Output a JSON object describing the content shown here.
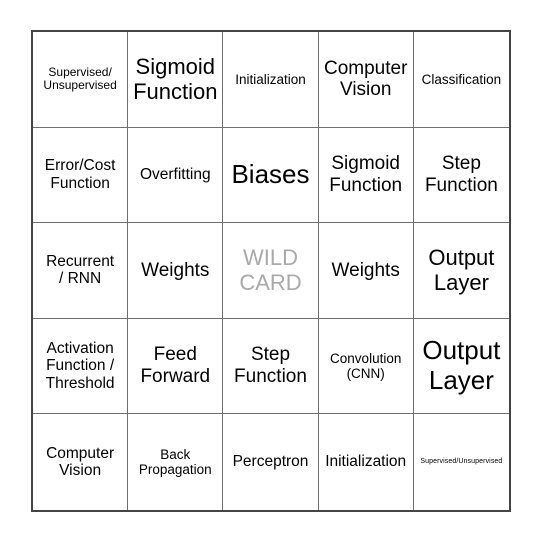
{
  "card": {
    "name": "neural-network-terms-bingo-card",
    "free_space_label": "WILD\nCARD",
    "free_space_color": "#a9a9a9",
    "border_color": "#444444",
    "grid_line_color": "#6e6e6e",
    "text_color": "#000000",
    "background_color": "#ffffff",
    "rows": 5,
    "columns": 5,
    "cells": [
      {
        "id": "r1c1",
        "text": "Supervised/\nUnsupervised",
        "size": "sz-xs",
        "free": false
      },
      {
        "id": "r1c2",
        "text": "Sigmoid\nFunction",
        "size": "sz-xl",
        "free": false
      },
      {
        "id": "r1c3",
        "text": "Initialization",
        "size": "sz-sm",
        "free": false
      },
      {
        "id": "r1c4",
        "text": "Computer\nVision",
        "size": "sz-lg",
        "free": false
      },
      {
        "id": "r1c5",
        "text": "Classification",
        "size": "sz-sm",
        "free": false
      },
      {
        "id": "r2c1",
        "text": "Error/Cost\nFunction",
        "size": "sz-md",
        "free": false
      },
      {
        "id": "r2c2",
        "text": "Overfitting",
        "size": "sz-md",
        "free": false
      },
      {
        "id": "r2c3",
        "text": "Biases",
        "size": "sz-xxl",
        "free": false
      },
      {
        "id": "r2c4",
        "text": "Sigmoid\nFunction",
        "size": "sz-lg",
        "free": false
      },
      {
        "id": "r2c5",
        "text": "Step\nFunction",
        "size": "sz-lg",
        "free": false
      },
      {
        "id": "r3c1",
        "text": "Recurrent\n/ RNN",
        "size": "sz-md",
        "free": false
      },
      {
        "id": "r3c2",
        "text": "Weights",
        "size": "sz-lg",
        "free": false
      },
      {
        "id": "r3c3",
        "text": "WILD\nCARD",
        "size": "sz-xl",
        "free": true
      },
      {
        "id": "r3c4",
        "text": "Weights",
        "size": "sz-lg",
        "free": false
      },
      {
        "id": "r3c5",
        "text": "Output\nLayer",
        "size": "sz-xl",
        "free": false
      },
      {
        "id": "r4c1",
        "text": "Activation\nFunction /\nThreshold",
        "size": "sz-md",
        "free": false
      },
      {
        "id": "r4c2",
        "text": "Feed\nForward",
        "size": "sz-lg",
        "free": false
      },
      {
        "id": "r4c3",
        "text": "Step\nFunction",
        "size": "sz-lg",
        "free": false
      },
      {
        "id": "r4c4",
        "text": "Convolution\n(CNN)",
        "size": "sz-sm",
        "free": false
      },
      {
        "id": "r4c5",
        "text": "Output\nLayer",
        "size": "sz-xxl",
        "free": false
      },
      {
        "id": "r5c1",
        "text": "Computer\nVision",
        "size": "sz-md",
        "free": false
      },
      {
        "id": "r5c2",
        "text": "Back\nPropagation",
        "size": "sz-sm",
        "free": false
      },
      {
        "id": "r5c3",
        "text": "Perceptron",
        "size": "sz-md",
        "free": false
      },
      {
        "id": "r5c4",
        "text": "Initialization",
        "size": "sz-md",
        "free": false
      },
      {
        "id": "r5c5",
        "text": "Supervised/Unsupervised",
        "size": "sz-xxs",
        "free": false
      }
    ]
  }
}
